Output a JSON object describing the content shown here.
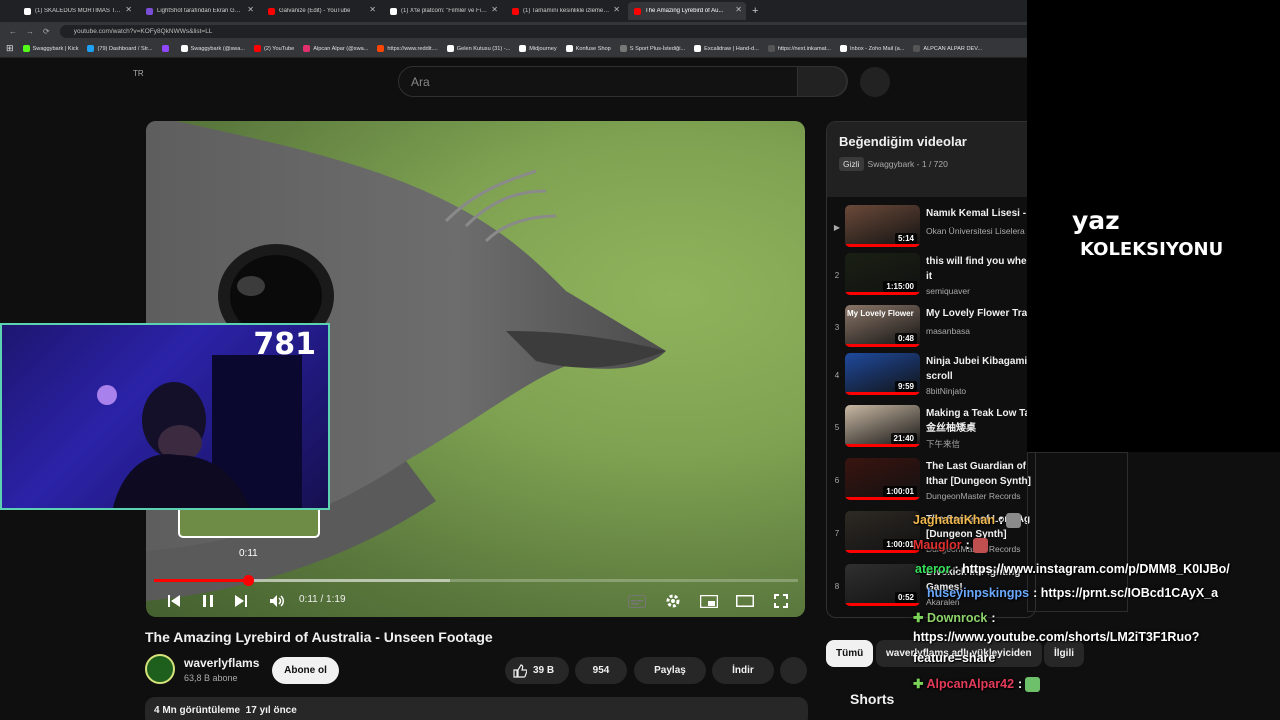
{
  "browser": {
    "tabs": [
      {
        "label": "(1) SKALEDUS MORTIMAS Topl...",
        "color": "#ffffff"
      },
      {
        "label": "LightShot tarafından Ekran Görü...",
        "color": "#7b4ed6"
      },
      {
        "label": "Galvanize (Edit) - YouTube",
        "color": "#ff0000"
      },
      {
        "label": "(1) X'te platcom: \"Filmler ve Fili...",
        "color": "#ffffff"
      },
      {
        "label": "(1) Tamamını kesinlikle izlemen...",
        "color": "#ff0000"
      },
      {
        "label": "The Amazing Lyrebird of Au...",
        "color": "#ff0000"
      }
    ],
    "url": "youtube.com/watch?v=KOFy8QkNWWs&list=LL",
    "bookmarks": [
      {
        "label": "Swaggybark | Kick",
        "color": "#53fc18"
      },
      {
        "label": "(79) Dashboard / Str...",
        "color": "#1da1f2"
      },
      {
        "label": "",
        "color": "#9146ff"
      },
      {
        "label": "Swaggybark (@swa...",
        "color": "#ffffff"
      },
      {
        "label": "(2) YouTube",
        "color": "#ff0000"
      },
      {
        "label": "Alpcan Alpar (@swa...",
        "color": "#e1306c"
      },
      {
        "label": "https://www.reddit....",
        "color": "#ff4500"
      },
      {
        "label": "Gelen Kutusu (31) -...",
        "color": "#ffffff"
      },
      {
        "label": "Midjourney",
        "color": "#ffffff"
      },
      {
        "label": "Konfuse Shop",
        "color": "#ffffff"
      },
      {
        "label": "S Sport Plus-İstediği...",
        "color": "#777777"
      },
      {
        "label": "Excalidraw | Hand-d...",
        "color": "#ffffff"
      },
      {
        "label": "https://next.inkamat...",
        "color": "#555555"
      },
      {
        "label": "Inbox - Zoho Mail (a...",
        "color": "#ffffff"
      },
      {
        "label": "ALPCAN ALPAR DEV...",
        "color": "#555555"
      }
    ]
  },
  "youtube": {
    "region": "TR",
    "search_placeholder": "Ara"
  },
  "player": {
    "current_time": "0:11",
    "duration": "1:19",
    "time_display": "0:11 / 1:19",
    "progress_fraction": 0.146,
    "buffered_fraction": 0.46,
    "hover_time": "0:11"
  },
  "webcam": {
    "counter": "781"
  },
  "video": {
    "title": "The Amazing Lyrebird of Australia - Unseen Footage",
    "channel": "waverlyflams",
    "subscribers": "63,8 B abone",
    "subscribe_label": "Abone ol",
    "likes": "39 B",
    "comments": "954",
    "share_label": "Paylaş",
    "download_label": "İndir",
    "views_date": "4 Mn görüntüleme  17 yıl önce"
  },
  "playlist": {
    "title": "Beğendiğim videolar",
    "privacy": "Gizli",
    "owner_progress": "Swaggybark - 1 / 720",
    "items": [
      {
        "index": "▶",
        "title": "Namık Kemal Lisesi -",
        "channel": "Okan Üniversitesi Liselera",
        "duration": "5:14",
        "thumb": "#6b4a3a"
      },
      {
        "index": "2",
        "title": "this will find you when it",
        "channel": "semiquaver",
        "duration": "1:15:00",
        "thumb": "#1a2014"
      },
      {
        "index": "3",
        "title": "My Lovely Flower Trai",
        "channel": "masanbasa",
        "duration": "0:48",
        "thumb": "#8a7668",
        "thumb_caption": "My Lovely Flower"
      },
      {
        "index": "4",
        "title": "Ninja Jubei Kibagami scroll",
        "channel": "8bitNinjato",
        "duration": "9:59",
        "thumb": "#1f4a9e"
      },
      {
        "index": "5",
        "title": "Making a Teak Low Ta 金丝柚矮桌",
        "channel": "下午来信",
        "duration": "21:40",
        "thumb": "#c9b9a4"
      },
      {
        "index": "6",
        "title": "The Last Guardian of Ithar [Dungeon Synth]",
        "channel": "DungeonMaster Records",
        "duration": "1:00:01",
        "thumb": "#3a1410"
      },
      {
        "index": "7",
        "title": "The Secret of Lord Ag [Dungeon Synth]",
        "channel": "DungeonMaster Records",
        "duration": "1:00:01",
        "thumb": "#2e2a24"
      },
      {
        "index": "8",
        "title": "Divekick in Fighting Games!",
        "channel": "Akaralen",
        "duration": "0:52",
        "thumb": "#303030"
      }
    ]
  },
  "overlay": {
    "line1": "yaz",
    "line2": "KOLEKSIYONU"
  },
  "chips": [
    {
      "label": "Tümü",
      "active": true
    },
    {
      "label": "waverlyflams adlı yükleyiciden",
      "active": false
    },
    {
      "label": "İlgili",
      "active": false
    }
  ],
  "shorts_label": "Shorts",
  "chat": [
    {
      "user": "JaghataiKhan",
      "user_color": "#f0b84e",
      "text": ":",
      "emote": "#8a8a8a"
    },
    {
      "user": "Mauglor",
      "user_color": "#e03030",
      "text": ":",
      "emote": "#c05050"
    },
    {
      "user": "ateror",
      "user_color": "#36e05a",
      "text": ": https://www.instagram.com/p/DMM8_K0IJBo/"
    },
    {
      "user": "huseyinpskingps",
      "user_color": "#6aa9ff",
      "text": ": https://prnt.sc/IOBcd1CAyX_a"
    },
    {
      "user": "Downrock",
      "user_color": "#8fd46b",
      "text": ":"
    },
    {
      "user": "",
      "user_color": "#ffffff",
      "text": "https://www.youtube.com/shorts/LM2iT3F1Ruo?"
    },
    {
      "user": "",
      "user_color": "#ffffff",
      "text": "feature=share"
    },
    {
      "user": "AlpcanAlpar42",
      "user_color": "#e33b5a",
      "text": ":",
      "emote": "#6fc06a"
    }
  ]
}
